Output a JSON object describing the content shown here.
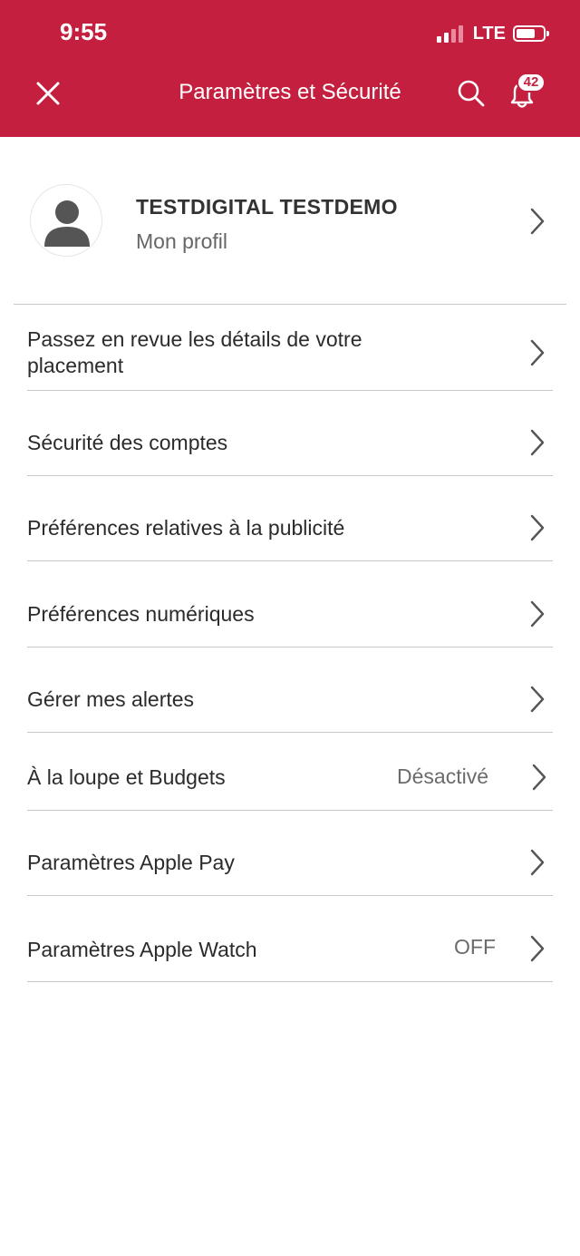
{
  "status_bar": {
    "time": "9:55",
    "network": "LTE"
  },
  "header": {
    "title": "Paramètres et Sécurité",
    "notification_count": "42",
    "background_color": "#c41f3e"
  },
  "profile": {
    "name": "TESTDIGITAL TESTDEMO",
    "subtitle": "Mon profil"
  },
  "menu": {
    "items": [
      {
        "label": "Passez en revue les détails de votre placement",
        "value": ""
      },
      {
        "label": "Sécurité des comptes",
        "value": ""
      },
      {
        "label": "Préférences relatives à la publicité",
        "value": ""
      },
      {
        "label": "Préférences numériques",
        "value": ""
      },
      {
        "label": "Gérer mes alertes",
        "value": ""
      },
      {
        "label": "À la loupe et Budgets",
        "value": "Désactivé"
      },
      {
        "label": "Paramètres Apple Pay",
        "value": ""
      },
      {
        "label": "Paramètres Apple Watch",
        "value": "OFF"
      }
    ]
  },
  "icons": {
    "close": "close-icon",
    "search": "search-icon",
    "notifications": "bell-icon",
    "avatar": "person-icon",
    "chevron": "chevron-right-icon"
  }
}
